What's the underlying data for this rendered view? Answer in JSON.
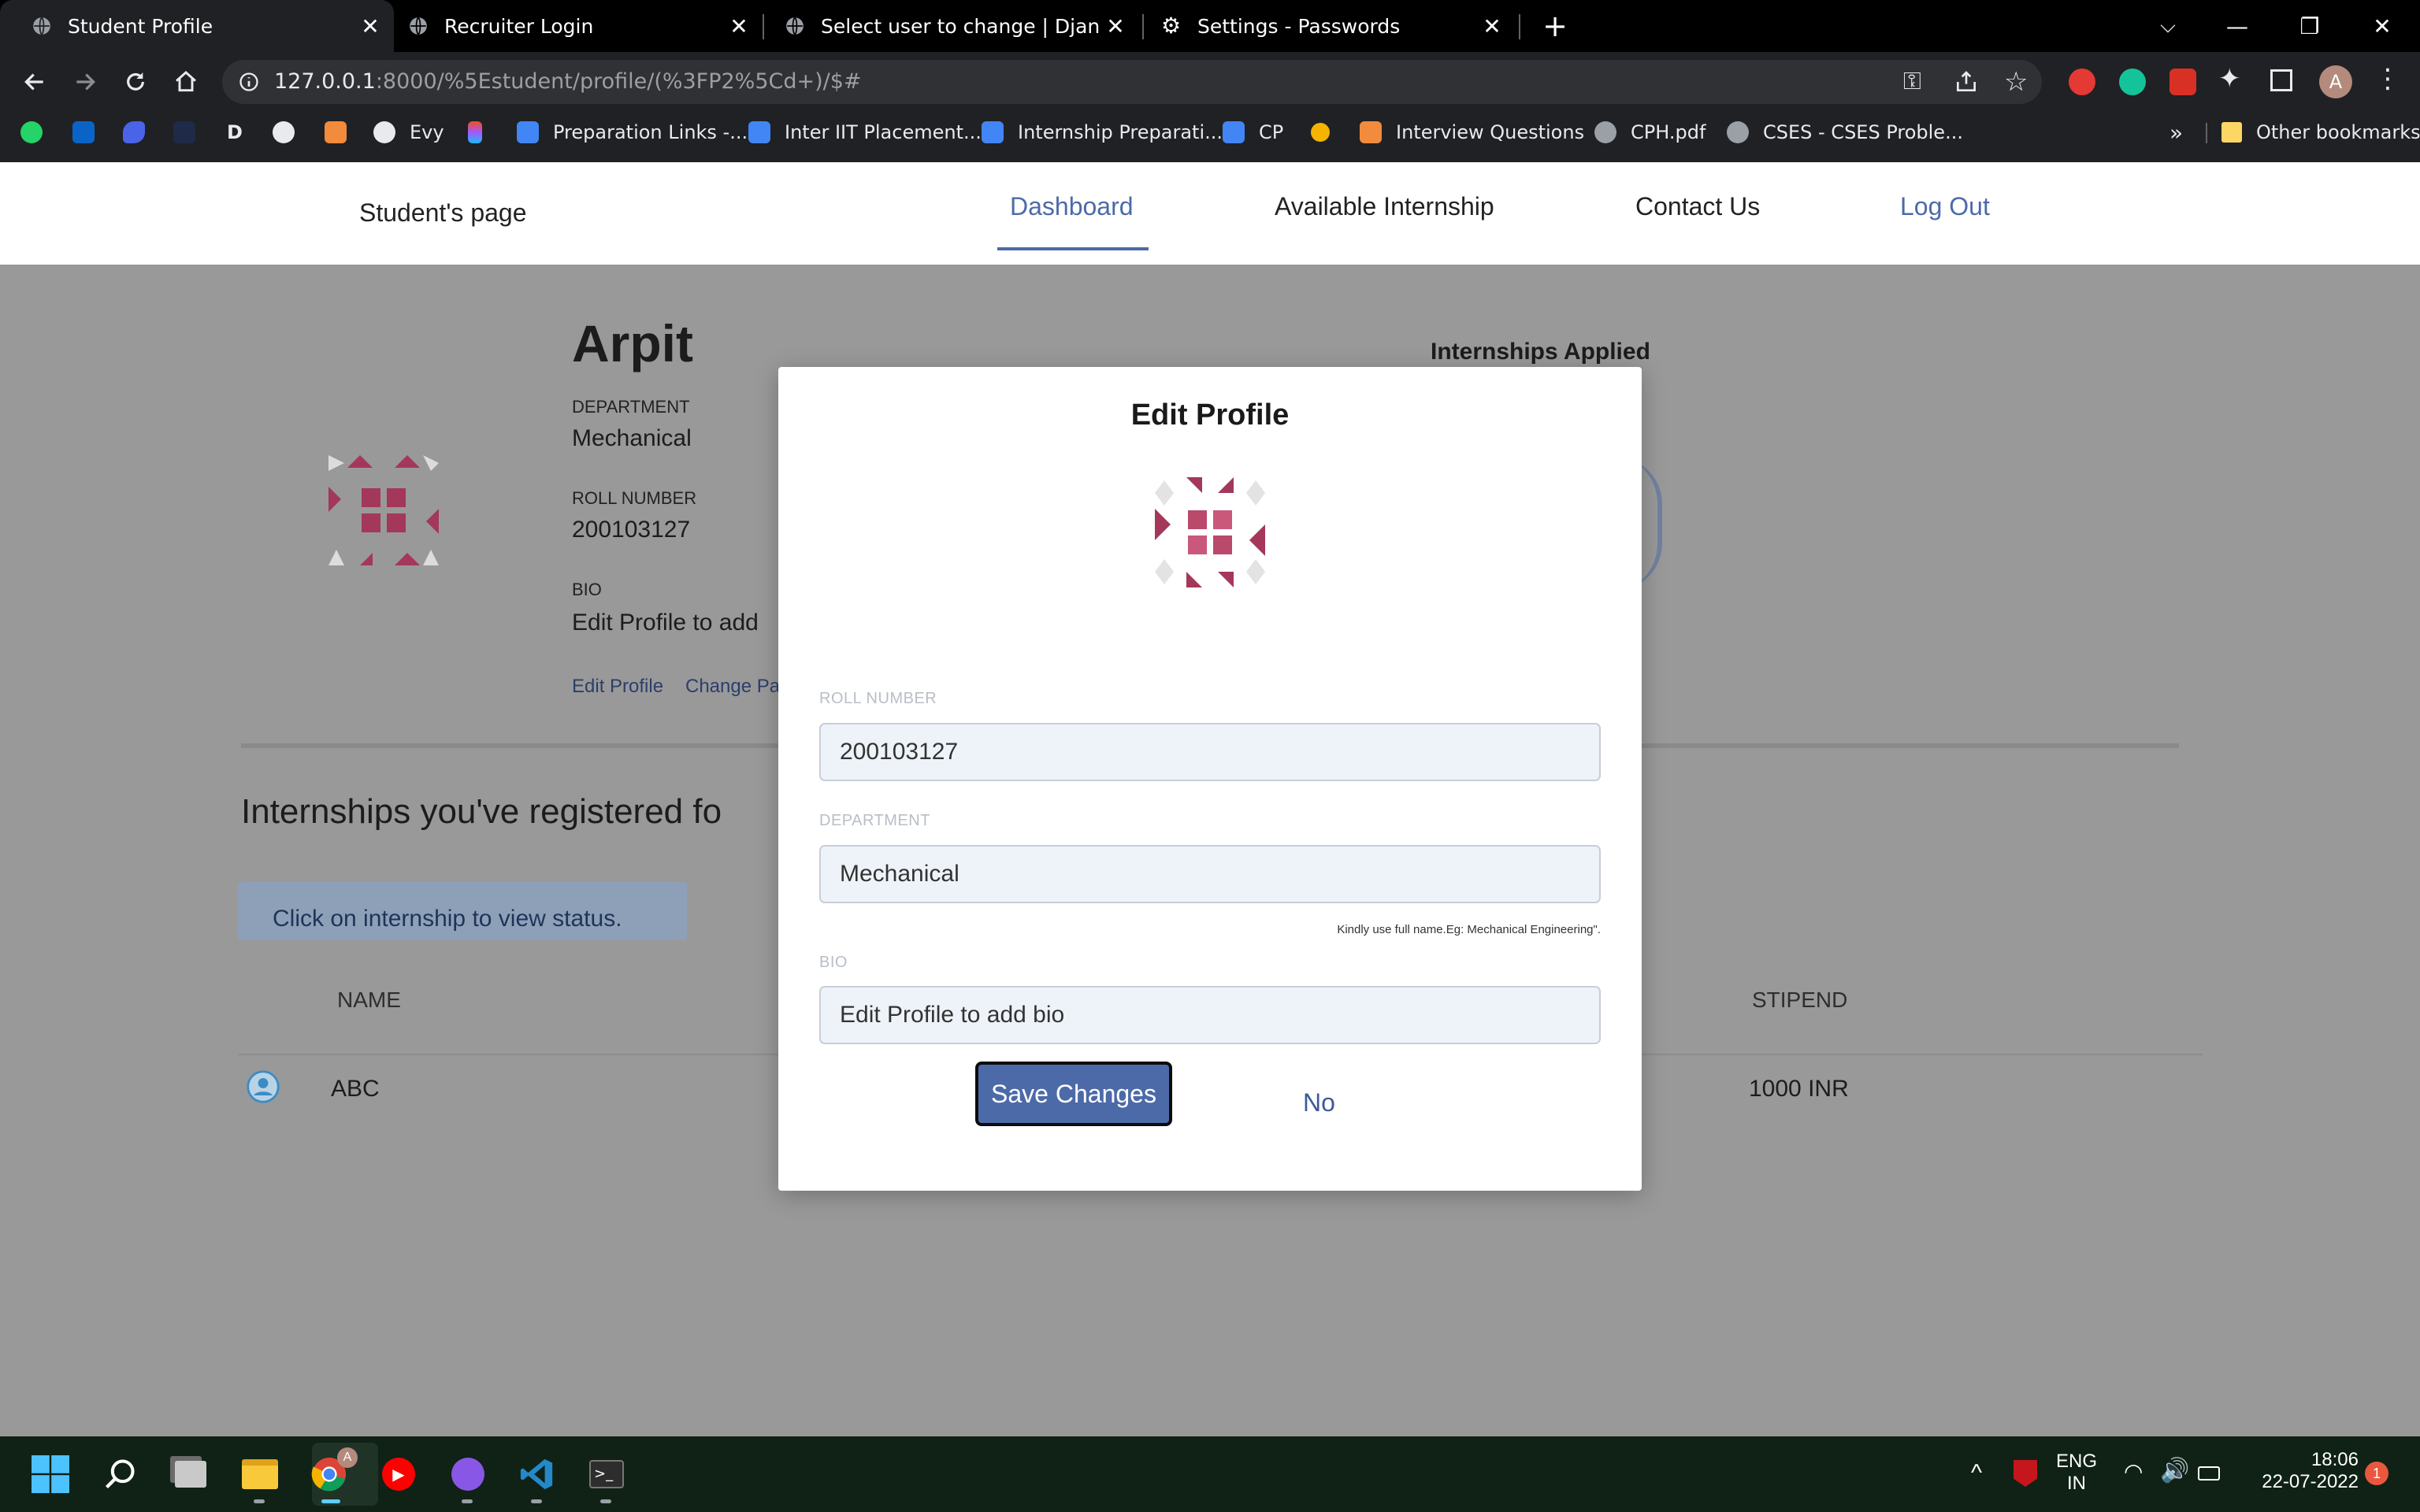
{
  "browser": {
    "tabs": [
      {
        "title": "Student Profile",
        "icon": "globe-icon",
        "active": true
      },
      {
        "title": "Recruiter Login",
        "icon": "globe-icon",
        "active": false
      },
      {
        "title": "Select user to change | Django si",
        "icon": "globe-icon",
        "active": false
      },
      {
        "title": "Settings - Passwords",
        "icon": "gear-icon",
        "active": false
      }
    ],
    "url_host": "127.0.0.1",
    "url_rest": ":8000/%5Estudent/profile/(%3FP2%5Cd+)/$#",
    "profile_initial": "A",
    "bookmarks": [
      {
        "label": "Evy",
        "icon": "github-icon"
      },
      {
        "label": "Preparation Links -...",
        "icon": "docs-icon"
      },
      {
        "label": "Inter IIT Placement...",
        "icon": "docs-icon"
      },
      {
        "label": "Internship Preparati...",
        "icon": "docs-icon"
      },
      {
        "label": "CP",
        "icon": "docs-icon"
      },
      {
        "label": "Interview Questions",
        "icon": "bookmark-icon"
      },
      {
        "label": "CPH.pdf",
        "icon": "globe-icon"
      },
      {
        "label": "CSES - CSES Proble...",
        "icon": "globe-icon"
      }
    ],
    "overflow": "»",
    "other_bookmarks": "Other bookmarks",
    "bookmark_icon_D": "D"
  },
  "navbar": {
    "brand": "Student's page",
    "links": [
      "Dashboard",
      "Available Internship",
      "Contact Us",
      "Log Out"
    ]
  },
  "profile": {
    "name": "Arpit",
    "department_label": "DEPARTMENT",
    "department": "Mechanical",
    "roll_label": "ROLL NUMBER",
    "roll": "200103127",
    "bio_label": "BIO",
    "bio": "Edit Profile to add",
    "edit_link": "Edit Profile",
    "change_link": "Change Pa",
    "applied_heading": "Internships Applied"
  },
  "registered": {
    "heading": "Internships you've registered fo",
    "info": "Click on internship to view status.",
    "col_name": "NAME",
    "col_stipend": "STIPEND",
    "rows": [
      {
        "name": "ABC",
        "stipend": "1000 INR"
      }
    ]
  },
  "modal": {
    "title": "Edit Profile",
    "roll_label": "ROLL NUMBER",
    "roll_value": "200103127",
    "dept_label": "DEPARTMENT",
    "dept_value": "Mechanical",
    "hint": "Kindly use full name.Eg: Mechanical Engineering\".",
    "bio_label": "BIO",
    "bio_value": "Edit Profile to add bio",
    "save": "Save Changes",
    "no": "No"
  },
  "taskbar": {
    "lang1": "ENG",
    "lang2": "IN",
    "time": "18:06",
    "date": "22-07-2022",
    "notification_count": "1",
    "chrome_badge": "A"
  },
  "colors": {
    "accent": "#4d6aa8",
    "identicon": "#a3385a"
  }
}
